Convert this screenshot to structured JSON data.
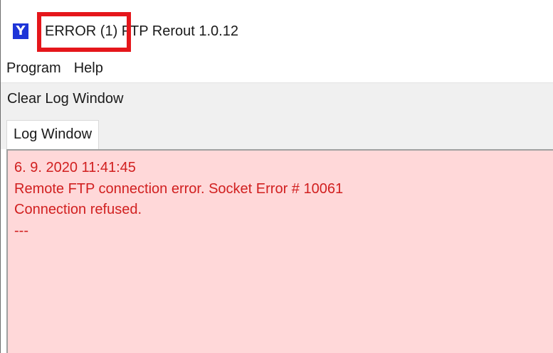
{
  "window": {
    "app_icon_glyph": "Y",
    "title_error": "ERROR (1)",
    "title_rest": " FTP Rerout 1.0.12",
    "error_highlight_color": "#e5161b"
  },
  "menu": {
    "items": [
      {
        "label": "Program"
      },
      {
        "label": "Help"
      }
    ]
  },
  "toolbar": {
    "clear_label": "Clear Log Window"
  },
  "tabs": [
    {
      "label": "Log Window",
      "active": true
    }
  ],
  "log": {
    "background": "#ffd8d9",
    "text_color": "#d11f1f",
    "lines": [
      "6. 9. 2020 11:41:45",
      "Remote FTP connection error. Socket Error # 10061",
      "Connection refused.",
      "---"
    ]
  }
}
